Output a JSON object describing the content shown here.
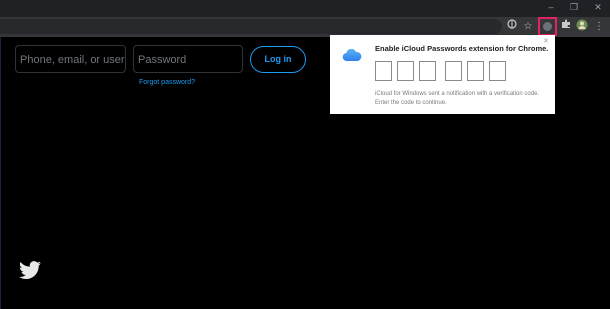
{
  "window": {
    "controls": [
      "–",
      "❐",
      "✕"
    ]
  },
  "toolbar": {
    "icons": [
      "translate-icon",
      "star-icon",
      "icloud-extension-icon",
      "puzzle-icon",
      "profile-avatar-icon",
      "menu-icon"
    ]
  },
  "login": {
    "username_placeholder": "Phone, email, or user...",
    "password_placeholder": "Password",
    "login_label": "Log in",
    "forgot_label": "Forgot password?"
  },
  "popup": {
    "title": "Enable iCloud Passwords extension for Chrome.",
    "description": "iCloud for Windows sent a notification with a verification code. Enter the code to continue.",
    "close": "✕",
    "code_length": 6
  },
  "colors": {
    "accent": "#1d9bf0",
    "highlight": "#e52165"
  }
}
